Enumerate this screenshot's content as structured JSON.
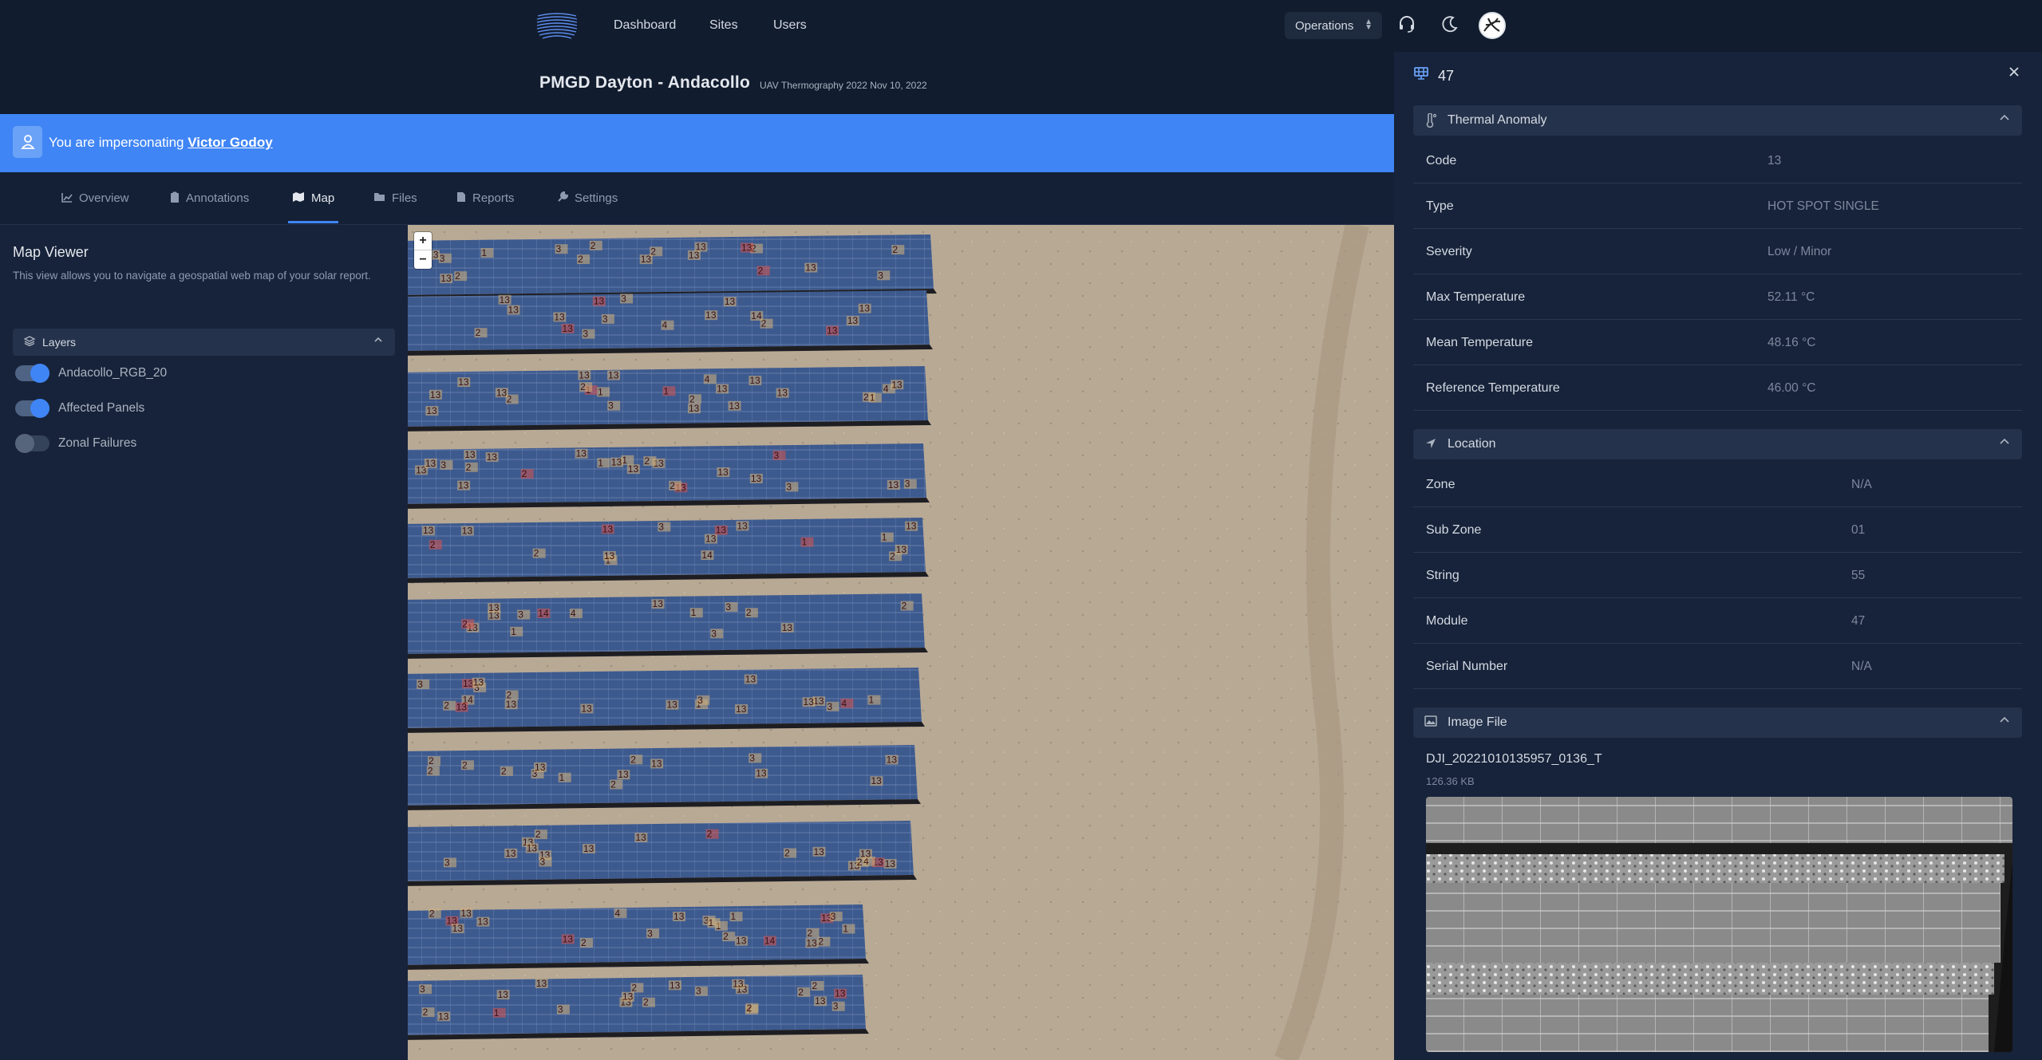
{
  "nav": {
    "links": [
      "Dashboard",
      "Sites",
      "Users"
    ],
    "org_select": "Operations",
    "icons": [
      "headset-icon",
      "moon-icon"
    ]
  },
  "header": {
    "site_title": "PMGD Dayton - Andacollo",
    "inspection": "UAV Thermography 2022 Nov 10, 2022"
  },
  "banner": {
    "prefix": "You are impersonating",
    "user": "Victor Godoy"
  },
  "tabs": [
    "Overview",
    "Annotations",
    "Map",
    "Files",
    "Reports",
    "Settings"
  ],
  "active_tab": "Map",
  "map_viewer": {
    "title": "Map Viewer",
    "description": "This view allows you to navigate a geospatial web map of your solar report.",
    "layers_title": "Layers",
    "layers": [
      {
        "name": "Andacollo_RGB_20",
        "enabled": true
      },
      {
        "name": "Affected Panels",
        "enabled": true
      },
      {
        "name": "Zonal Failures",
        "enabled": false
      }
    ]
  },
  "map": {
    "zoom_in": "+",
    "zoom_out": "−",
    "marker_labels": [
      "13",
      "2",
      "3",
      "1",
      "4",
      "14"
    ]
  },
  "detail": {
    "title": "47",
    "thermal_anomaly": {
      "title": "Thermal Anomaly",
      "rows": [
        {
          "key": "Code",
          "value": "13"
        },
        {
          "key": "Type",
          "value": "HOT SPOT SINGLE"
        },
        {
          "key": "Severity",
          "value": "Low / Minor"
        },
        {
          "key": "Max Temperature",
          "value": "52.11 °C"
        },
        {
          "key": "Mean Temperature",
          "value": "48.16 °C"
        },
        {
          "key": "Reference Temperature",
          "value": "46.00 °C"
        }
      ]
    },
    "location": {
      "title": "Location",
      "rows": [
        {
          "key": "Zone",
          "value": "N/A"
        },
        {
          "key": "Sub Zone",
          "value": "01"
        },
        {
          "key": "String",
          "value": "55"
        },
        {
          "key": "Module",
          "value": "47"
        },
        {
          "key": "Serial Number",
          "value": "N/A"
        }
      ]
    },
    "image_file": {
      "title": "Image File",
      "name": "DJI_20221010135957_0136_T",
      "size": "126.36 KB"
    }
  },
  "colors": {
    "accent": "#3f85f5",
    "background": "#0f1a2d",
    "panel": "#17233a",
    "marker_normal": "#d4b27a",
    "marker_severe": "#d9534f"
  }
}
